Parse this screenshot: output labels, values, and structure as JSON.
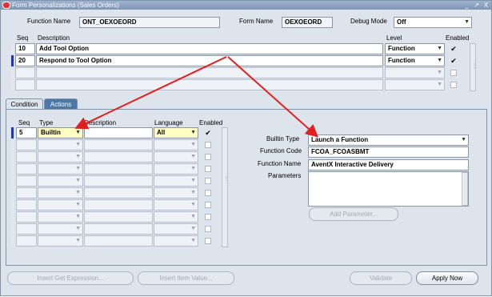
{
  "window": {
    "title": "Form Personalizations (Sales Orders)",
    "controls": [
      "_",
      "↗",
      "X"
    ]
  },
  "header": {
    "function_name_label": "Function Name",
    "function_name_value": "ONT_OEXOEORD",
    "form_name_label": "Form Name",
    "form_name_value": "OEXOEORD",
    "debug_mode_label": "Debug Mode",
    "debug_mode_value": "Off"
  },
  "rules_table": {
    "headers": {
      "seq": "Seq",
      "description": "Description",
      "level": "Level",
      "enabled": "Enabled"
    },
    "rows": [
      {
        "seq": "10",
        "description": "Add Tool Option",
        "level": "Function",
        "enabled": true
      },
      {
        "seq": "20",
        "description": "Respond to Tool Option",
        "level": "Function",
        "enabled": true
      }
    ]
  },
  "tabs": {
    "condition": "Condition",
    "actions": "Actions"
  },
  "actions_table": {
    "headers": {
      "seq": "Seq",
      "type": "Type",
      "description": "Description",
      "language": "Language",
      "enabled": "Enabled"
    },
    "rows": [
      {
        "seq": "5",
        "type": "Builtin",
        "description": "",
        "language": "All",
        "enabled": true
      }
    ]
  },
  "builtin": {
    "builtin_type_label": "Builtin Type",
    "builtin_type_value": "Launch a Function",
    "function_code_label": "Function Code",
    "function_code_value": "FCOA_FCOASBMT",
    "function_name_label": "Function Name",
    "function_name_value": "AventX Interactive Delivery",
    "parameters_label": "Parameters",
    "add_parameter_button": "Add Parameter..."
  },
  "footer": {
    "insert_get_expression": "Insert Get Expression...",
    "insert_item_value": "Insert Item Value...",
    "validate": "Validate",
    "apply_now": "Apply Now"
  },
  "colors": {
    "arrow": "#e02020",
    "active_tab": "#4a78a7",
    "current_row_marker": "#1a35c9",
    "highlight_field": "#ffffc4"
  }
}
